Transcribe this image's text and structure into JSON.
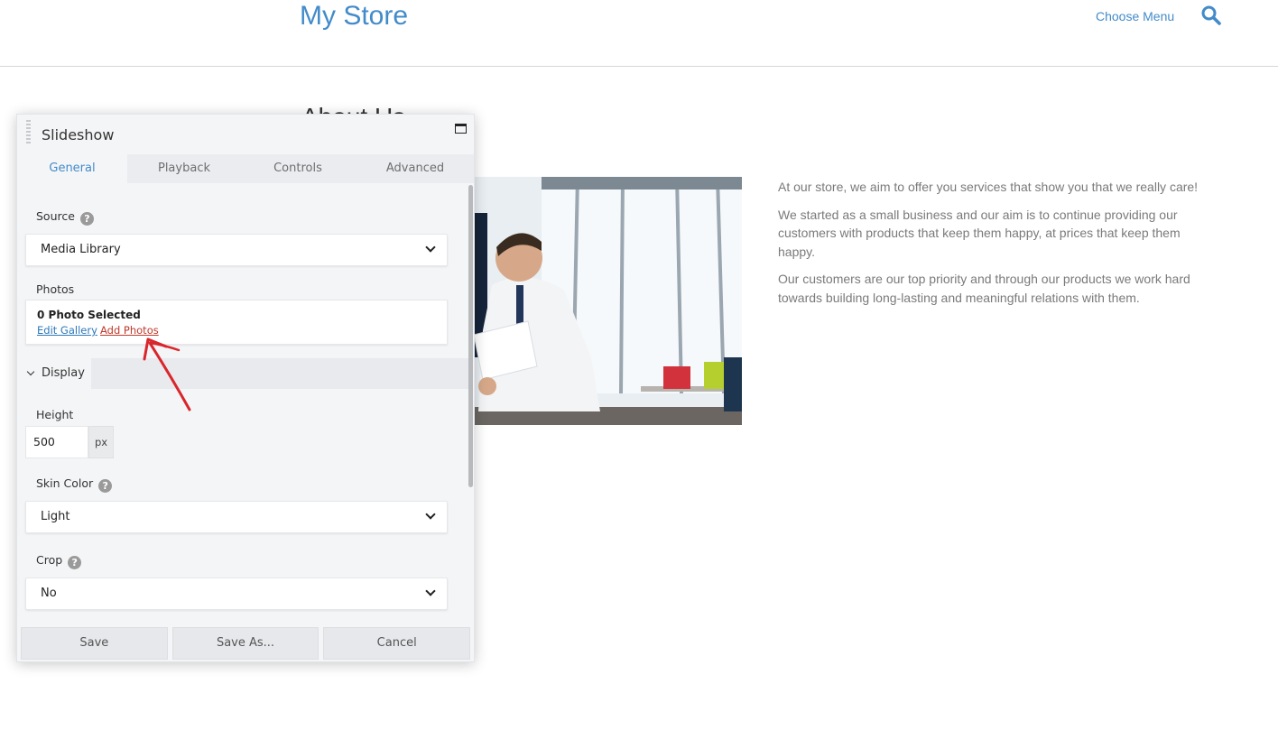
{
  "site": {
    "title": "My Store",
    "menu_label": "Choose Menu"
  },
  "page": {
    "heading_partial": "About Us",
    "paragraphs": [
      "At our store, we aim to offer you services that show you that we really care!",
      "We started as a small business and our aim is to continue providing our customers with products that keep them happy, at prices that keep them happy.",
      "Our customers are our top priority and through our products we work hard towards building long-lasting and meaningful relations with them."
    ]
  },
  "panel": {
    "title": "Slideshow",
    "tabs": [
      {
        "label": "General",
        "active": true
      },
      {
        "label": "Playback",
        "active": false
      },
      {
        "label": "Controls",
        "active": false
      },
      {
        "label": "Advanced",
        "active": false
      }
    ],
    "source": {
      "label": "Source",
      "value": "Media Library"
    },
    "photos": {
      "label": "Photos",
      "count_text": "0 Photo Selected",
      "edit_link": "Edit Gallery",
      "add_link": "Add Photos"
    },
    "display_section": "Display",
    "height": {
      "label": "Height",
      "value": "500",
      "unit": "px"
    },
    "skin_color": {
      "label": "Skin Color",
      "value": "Light"
    },
    "crop": {
      "label": "Crop",
      "value": "No"
    },
    "help_glyph": "?",
    "buttons": {
      "save": "Save",
      "save_as": "Save As...",
      "cancel": "Cancel"
    }
  },
  "colors": {
    "accent": "#428bca",
    "annotation_arrow": "#d9262c"
  },
  "icons": [
    "search-icon",
    "maximize-icon",
    "chevron-down-icon",
    "help-icon",
    "drag-handle-icon"
  ]
}
